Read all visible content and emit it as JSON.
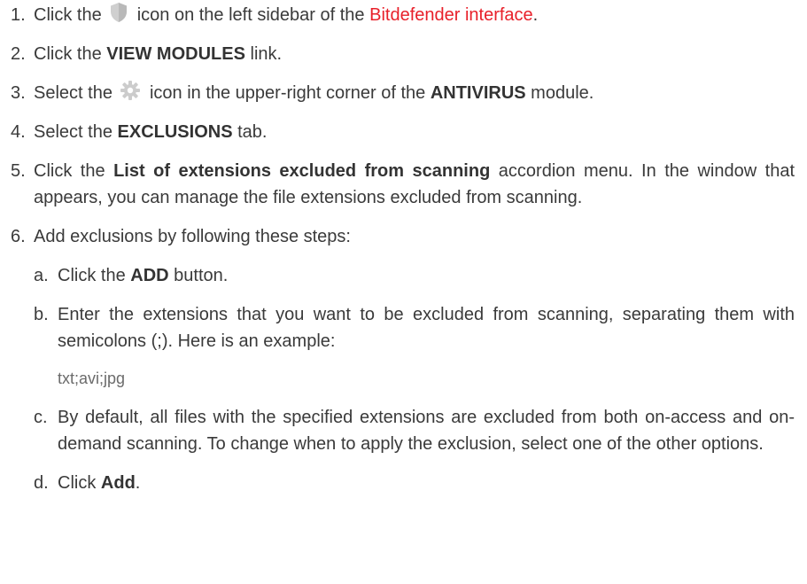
{
  "steps": [
    {
      "number": "1.",
      "pre": "Click the",
      "icon": "shield-icon",
      "mid": "icon on the left sidebar of the",
      "link": "Bitdefender interface",
      "post": "."
    },
    {
      "number": "2.",
      "pre": "Click the",
      "bold": "VIEW MODULES",
      "post": "link."
    },
    {
      "number": "3.",
      "pre": "Select the",
      "icon": "gear-icon",
      "mid": "icon in the upper-right corner of the",
      "bold": "ANTIVIRUS",
      "post": "module."
    },
    {
      "number": "4.",
      "pre": "Select the",
      "bold": "EXCLUSIONS",
      "post": "tab."
    },
    {
      "number": "5.",
      "pre": "Click the",
      "bold": "List of extensions excluded from scanning",
      "post": "accordion menu. In the window that appears, you can manage the file extensions excluded from scanning."
    },
    {
      "number": "6.",
      "text": "Add exclusions by following these steps:",
      "substeps": [
        {
          "letter": "a.",
          "pre": "Click the",
          "bold": "ADD",
          "post": "button."
        },
        {
          "letter": "b.",
          "text": "Enter the extensions that you want to be excluded from scanning, separating them with semicolons (;). Here is an example:",
          "example": "txt;avi;jpg"
        },
        {
          "letter": "c.",
          "text": "By default, all files with the specified extensions are excluded from both on-access and on-demand scanning. To change when to apply the exclusion, select one of the other options."
        },
        {
          "letter": "d.",
          "pre": "Click",
          "bold": "Add",
          "post": "."
        }
      ]
    }
  ],
  "colors": {
    "link": "#e8202a",
    "text": "#3a3a3a",
    "icon": "#c8c8c8"
  }
}
